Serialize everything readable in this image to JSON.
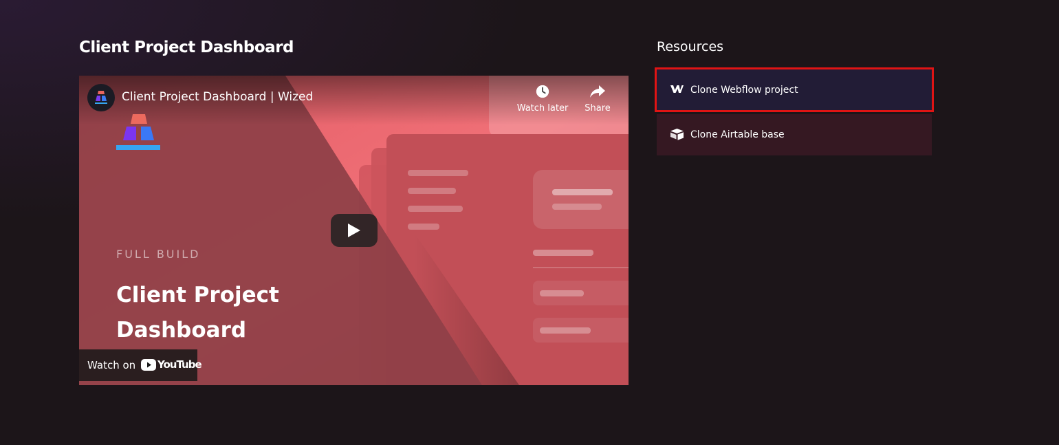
{
  "page": {
    "title": "Client Project Dashboard"
  },
  "video": {
    "title": "Client Project Dashboard | Wized",
    "watch_later_label": "Watch later",
    "share_label": "Share",
    "eyebrow": "FULL BUILD",
    "heading": "Client Project Dashboard",
    "watch_on_label": "Watch on",
    "youtube_wordmark": "YouTube",
    "icons": [
      "wized-logo-icon",
      "clock-icon",
      "share-arrow-icon",
      "play-icon",
      "youtube-logo-icon"
    ]
  },
  "resources": {
    "heading": "Resources",
    "items": [
      {
        "label": "Clone Webflow project",
        "icon": "webflow-icon",
        "highlighted": true
      },
      {
        "label": "Clone Airtable base",
        "icon": "airtable-icon",
        "highlighted": false
      }
    ]
  },
  "colors": {
    "background": "#1c1519",
    "video_accent": "#e86a70",
    "webflow_row": "#221c36",
    "airtable_row": "#351822",
    "highlight_border": "#e01414"
  }
}
